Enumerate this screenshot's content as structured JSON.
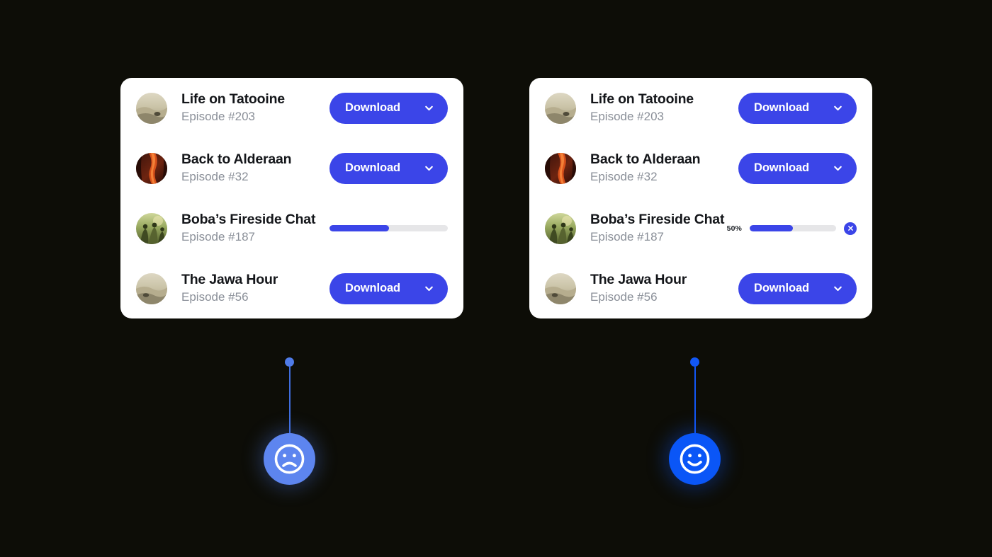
{
  "background_color": "#0d0d07",
  "accent_color": "#3b45e8",
  "cards": [
    {
      "name": "before-card",
      "rows": [
        {
          "title": "Life on Tatooine",
          "subtitle": "Episode #203",
          "artwork": "desert-landscape-thumbnail",
          "action": "download",
          "button_label": "Download",
          "chevron_icon": "chevron-down-icon"
        },
        {
          "title": "Back to Alderaan",
          "subtitle": "Episode #32",
          "artwork": "red-canyon-thumbnail",
          "action": "download",
          "button_label": "Download",
          "chevron_icon": "chevron-down-icon"
        },
        {
          "title": "Boba’s Fireside Chat",
          "subtitle": "Episode #187",
          "artwork": "green-figures-thumbnail",
          "action": "progress",
          "progress_percent": 50,
          "percent_label": null,
          "cancel_icon": null
        },
        {
          "title": "The Jawa Hour",
          "subtitle": "Episode #56",
          "artwork": "desert-landscape-thumbnail",
          "action": "download",
          "button_label": "Download",
          "chevron_icon": "chevron-down-icon"
        }
      ]
    },
    {
      "name": "after-card",
      "rows": [
        {
          "title": "Life on Tatooine",
          "subtitle": "Episode #203",
          "artwork": "desert-landscape-thumbnail",
          "action": "download",
          "button_label": "Download",
          "chevron_icon": "chevron-down-icon"
        },
        {
          "title": "Back to Alderaan",
          "subtitle": "Episode #32",
          "artwork": "red-canyon-thumbnail",
          "action": "download",
          "button_label": "Download",
          "chevron_icon": "chevron-down-icon"
        },
        {
          "title": "Boba’s Fireside Chat",
          "subtitle": "Episode #187",
          "artwork": "green-figures-thumbnail",
          "action": "progress",
          "progress_percent": 50,
          "percent_label": "50%",
          "cancel_icon": "close-icon"
        },
        {
          "title": "The Jawa Hour",
          "subtitle": "Episode #56",
          "artwork": "desert-landscape-thumbnail",
          "action": "download",
          "button_label": "Download",
          "chevron_icon": "chevron-down-icon"
        }
      ]
    }
  ],
  "verdicts": [
    {
      "name": "negative-verdict",
      "icon": "sad-face-icon",
      "color": "#5d85ef"
    },
    {
      "name": "positive-verdict",
      "icon": "happy-face-icon",
      "color": "#0a56f7"
    }
  ]
}
